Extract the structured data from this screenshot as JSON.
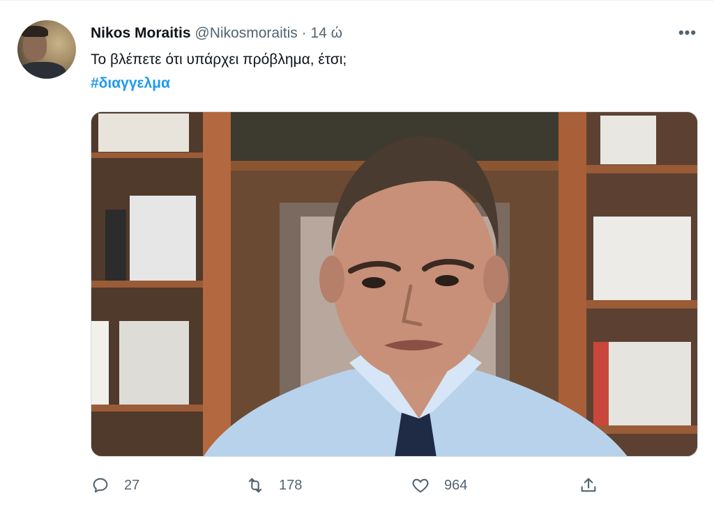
{
  "tweet": {
    "author_name": "Nikos Moraitis",
    "handle": "@Nikosmoraitis",
    "separator": "·",
    "time": "14 ώ",
    "text": "Το βλέπετε ότι υπάρχει πρόβλημα, έτσι;",
    "hashtag": "#διαγγελμα",
    "more_icon": "more-horizontal-icon",
    "more_label": "•••"
  },
  "actions": {
    "reply": {
      "icon": "reply-icon",
      "count": "27"
    },
    "retweet": {
      "icon": "retweet-icon",
      "count": "178"
    },
    "like": {
      "icon": "heart-icon",
      "count": "964"
    },
    "share": {
      "icon": "share-icon"
    }
  },
  "colors": {
    "accent": "#1d9bf0",
    "secondary_text": "#536471",
    "primary_text": "#0f1419"
  }
}
